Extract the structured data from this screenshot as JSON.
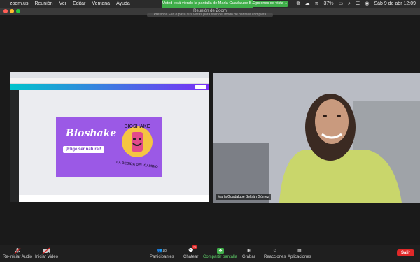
{
  "menubar": {
    "apple_icon": "apple-logo",
    "items": [
      "zoom.us",
      "Reunión",
      "Ver",
      "Editar",
      "Ventana",
      "Ayuda"
    ],
    "battery": "37%",
    "datetime": "Sáb 9 de abr 12:09",
    "icons": [
      "screen-share-icon",
      "cloud-icon",
      "wifi-icon",
      "battery-icon",
      "search-icon",
      "control-center-icon",
      "siri-icon"
    ]
  },
  "banner": {
    "sharing_text": "Usted está viendo la pantalla de María Guadalupe B...",
    "view_options": "Opciones de vista ⌄"
  },
  "window": {
    "title": "Reunión de Zoom",
    "hint": "Presiona Esc o pasa sus vistas para salir del modo de pantalla completa"
  },
  "shared_screen": {
    "brand": "Bioshake",
    "pill": "¡Elige ser natural!",
    "logo_text": "BIOSHAKE",
    "subtitle": "LA BEBIDA DEL CAMBIO",
    "colors": {
      "slide_bg": "#9b59e6",
      "canva_grad_start": "#00c4cc",
      "canva_grad_end": "#7b2ff7"
    }
  },
  "participant": {
    "name": "María Guadalupe Beltrán Gómez"
  },
  "toolbar": {
    "audio_label": "Re-iniciar Audio",
    "video_label": "Iniciar Video",
    "participants_label": "Participantes",
    "participants_count": "18",
    "chat_label": "Chatear",
    "chat_badge": "79",
    "share_label": "Compartir pantalla",
    "record_label": "Grabar",
    "reactions_label": "Reacciones",
    "apps_label": "Aplicaciones",
    "leave_label": "Salir"
  }
}
